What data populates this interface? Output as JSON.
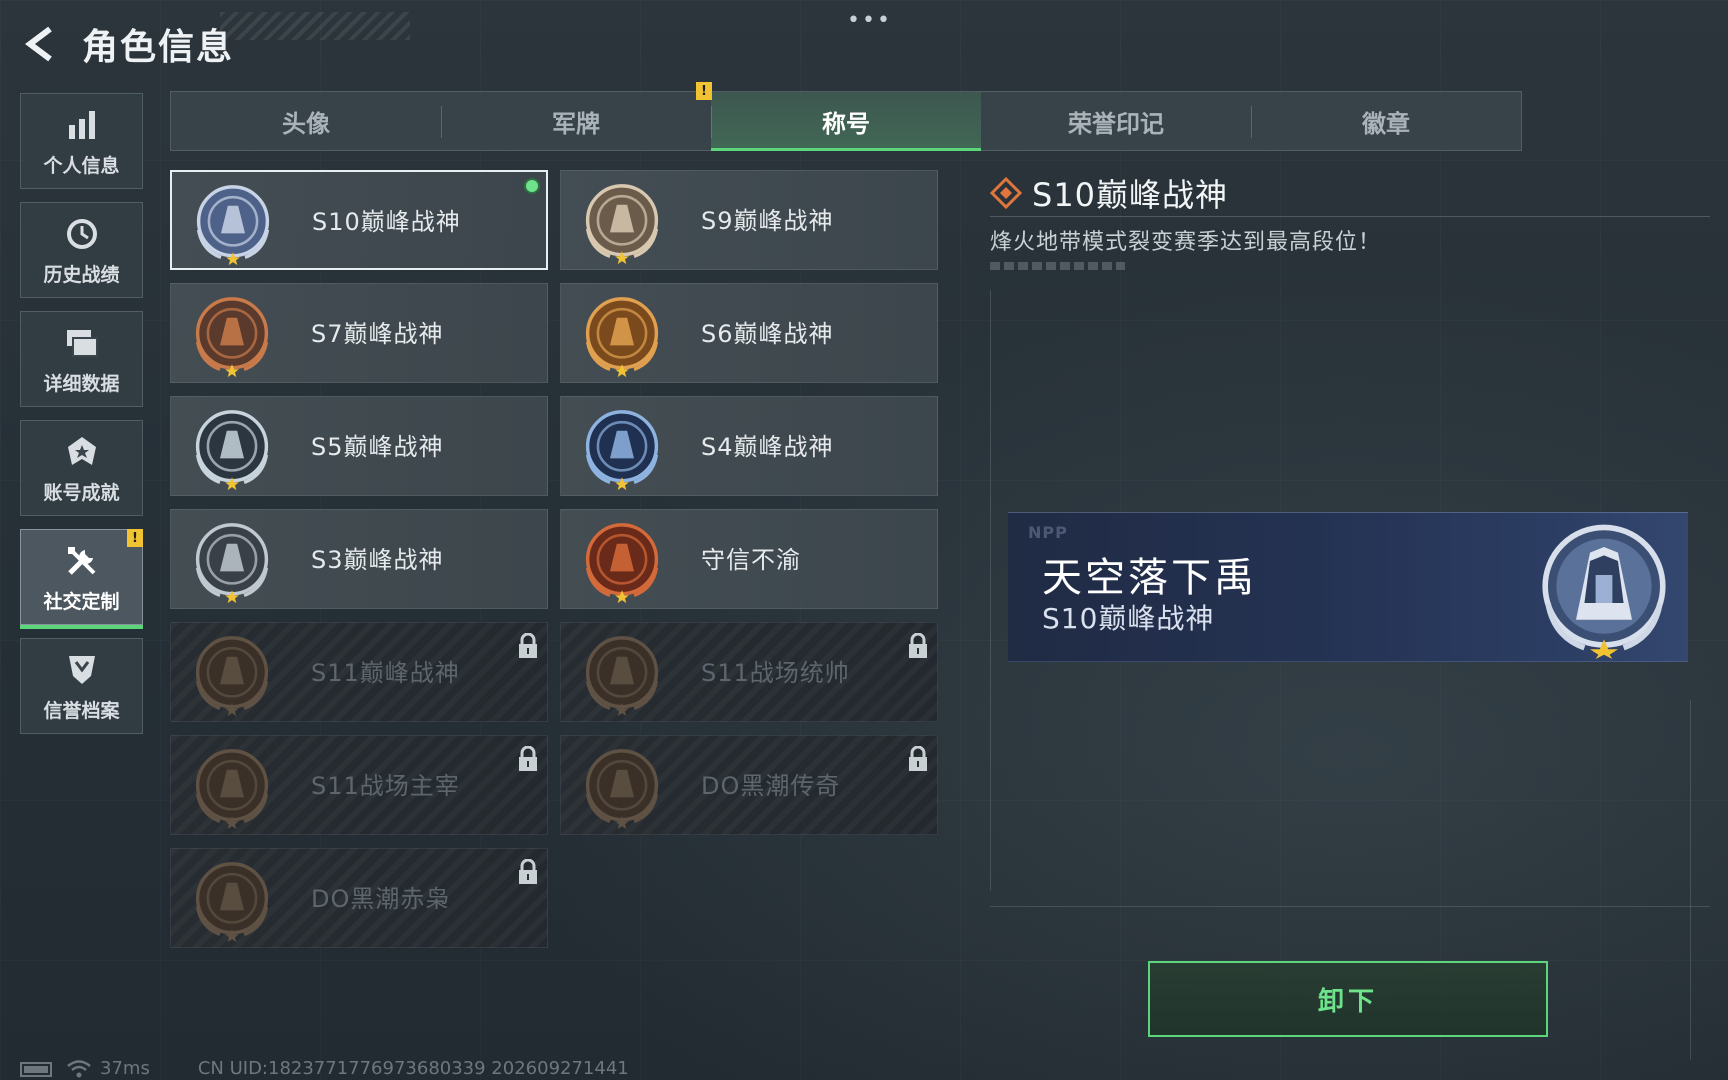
{
  "header": {
    "title": "角色信息"
  },
  "sidebar": {
    "items": [
      {
        "label": "个人信息",
        "icon": "bar-chart-icon"
      },
      {
        "label": "历史战绩",
        "icon": "clock-icon"
      },
      {
        "label": "详细数据",
        "icon": "stack-icon"
      },
      {
        "label": "账号成就",
        "icon": "star-badge-icon"
      },
      {
        "label": "社交定制",
        "icon": "tools-icon",
        "active": true,
        "alert": "!"
      },
      {
        "label": "信誉档案",
        "icon": "shield-chevron-icon"
      }
    ]
  },
  "tabs": [
    {
      "label": "头像"
    },
    {
      "label": "军牌",
      "alert": "!"
    },
    {
      "label": "称号",
      "active": true
    },
    {
      "label": "荣誉印记"
    },
    {
      "label": "徽章"
    }
  ],
  "titles": [
    {
      "name": "S10巅峰战神",
      "selected": true,
      "equipped": true,
      "locked": false
    },
    {
      "name": "S9巅峰战神",
      "locked": false
    },
    {
      "name": "S7巅峰战神",
      "locked": false
    },
    {
      "name": "S6巅峰战神",
      "locked": false
    },
    {
      "name": "S5巅峰战神",
      "locked": false
    },
    {
      "name": "S4巅峰战神",
      "locked": false
    },
    {
      "name": "S3巅峰战神",
      "locked": false
    },
    {
      "name": "守信不渝",
      "locked": false
    },
    {
      "name": "S11巅峰战神",
      "locked": true
    },
    {
      "name": "S11战场统帅",
      "locked": true
    },
    {
      "name": "S11战场主宰",
      "locked": true
    },
    {
      "name": "DO黑潮传奇",
      "locked": true
    },
    {
      "name": "DO黑潮赤枭",
      "locked": true
    }
  ],
  "detail": {
    "title": "S10巅峰战神",
    "description": "烽火地带模式裂变赛季达到最高段位！"
  },
  "preview": {
    "mark": "NPP",
    "player_name": "天空落下禹",
    "title": "S10巅峰战神"
  },
  "action": {
    "label": "卸下"
  },
  "footer": {
    "ping": "37ms",
    "uid": "CN UID:1823771776973680339 202609271441"
  },
  "colors": {
    "accent_green": "#5cd67a",
    "alert_yellow": "#f1c232",
    "preview_blue": "#243252"
  }
}
